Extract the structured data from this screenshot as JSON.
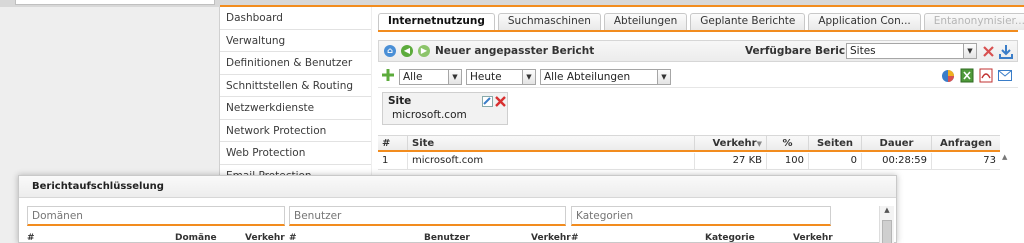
{
  "sidebar": {
    "items": [
      {
        "label": "Dashboard"
      },
      {
        "label": "Verwaltung"
      },
      {
        "label": "Definitionen & Benutzer"
      },
      {
        "label": "Schnittstellen & Routing"
      },
      {
        "label": "Netzwerkdienste"
      },
      {
        "label": "Network Protection"
      },
      {
        "label": "Web Protection"
      },
      {
        "label": "Email Protection"
      }
    ]
  },
  "tabs": [
    {
      "label": "Internetnutzung"
    },
    {
      "label": "Suchmaschinen"
    },
    {
      "label": "Abteilungen"
    },
    {
      "label": "Geplante Berichte"
    },
    {
      "label": "Application Con..."
    },
    {
      "label": "Entanonymisier..."
    }
  ],
  "report_bar": {
    "title": "Neuer angepasster Bericht",
    "available_label": "Verfügbare Berichte:",
    "available_value": "Sites"
  },
  "filters": {
    "users": "Alle",
    "period": "Heute",
    "departments": "Alle Abteilungen"
  },
  "site_card": {
    "title": "Site",
    "value": "microsoft.com"
  },
  "table": {
    "headers": {
      "num": "#",
      "site": "Site",
      "traffic": "Verkehr",
      "percent": "%",
      "pages": "Seiten",
      "duration": "Dauer",
      "requests": "Anfragen"
    },
    "rows": [
      {
        "num": "1",
        "site": "microsoft.com",
        "traffic": "27 KB",
        "percent": "100",
        "pages": "0",
        "duration": "00:28:59",
        "requests": "73"
      }
    ]
  },
  "breakdown": {
    "title": "Berichtaufschlüsselung",
    "placeholders": {
      "domains": "Domänen",
      "users": "Benutzer",
      "categories": "Kategorien"
    },
    "columns": {
      "num": "#",
      "domain": "Domäne",
      "traffic": "Verkehr",
      "user": "Benutzer",
      "category": "Kategorie"
    }
  },
  "colors": {
    "accent": "#f28c1e"
  }
}
